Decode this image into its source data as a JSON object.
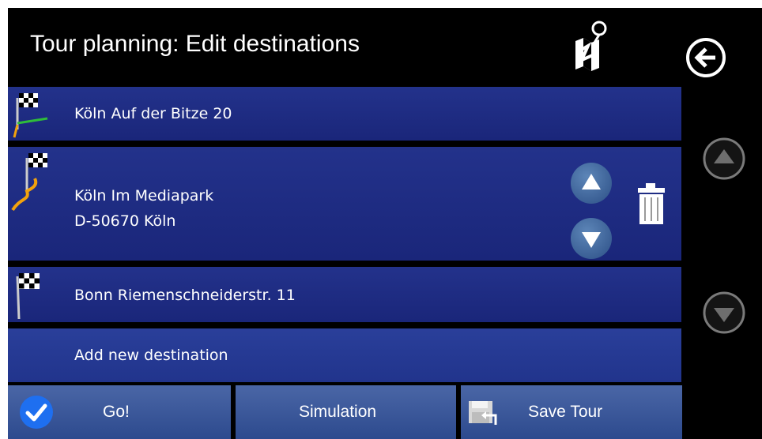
{
  "header": {
    "title": "Tour planning: Edit destinations",
    "map_icon": "map-pin-icon",
    "back_icon": "back-arrow-icon"
  },
  "destinations": [
    {
      "label": "Köln Auf der Bitze 20",
      "icon": "start-flag-icon"
    },
    {
      "line1": "Köln Im Mediapark",
      "line2": "D-50670 Köln",
      "icon": "via-flag-icon",
      "selected": true
    },
    {
      "label": "Bonn Riemenschneiderstr. 11",
      "icon": "end-flag-icon"
    }
  ],
  "add_new": "Add new destination",
  "bottom": {
    "go": "Go!",
    "simulation": "Simulation",
    "save": "Save Tour"
  },
  "colors": {
    "background": "#000000",
    "row": "#1f2d85",
    "button": "#3b5899",
    "check": "#1e6ff0",
    "route_orange": "#f2a20c",
    "route_green": "#2fbd3a"
  }
}
